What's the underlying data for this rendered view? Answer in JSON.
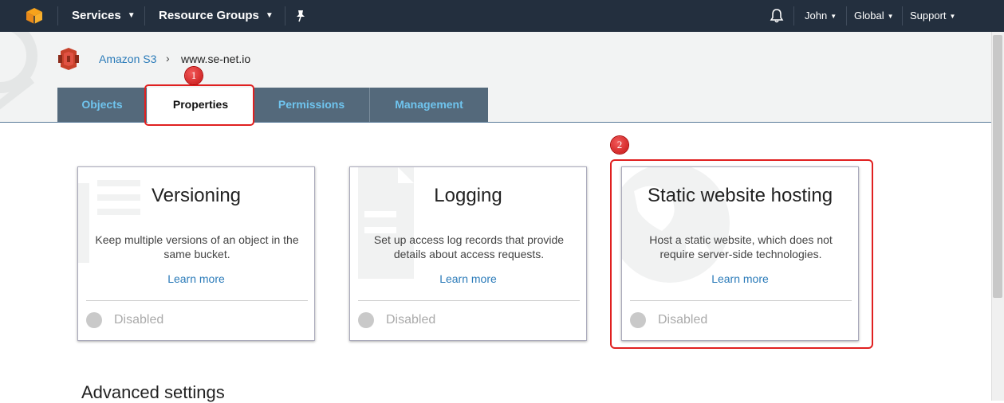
{
  "topnav": {
    "services_label": "Services",
    "resource_groups_label": "Resource Groups",
    "user_label": "John",
    "region_label": "Global",
    "support_label": "Support"
  },
  "breadcrumb": {
    "service_link": "Amazon S3",
    "separator": "›",
    "bucket_name": "www.se-net.io"
  },
  "tabs": [
    {
      "label": "Objects"
    },
    {
      "label": "Properties"
    },
    {
      "label": "Permissions"
    },
    {
      "label": "Management"
    }
  ],
  "badges": {
    "first": "1",
    "second": "2"
  },
  "cards": [
    {
      "title": "Versioning",
      "description": "Keep multiple versions of an object in the same bucket.",
      "link": "Learn more",
      "status": "Disabled"
    },
    {
      "title": "Logging",
      "description": "Set up access log records that provide details about access requests.",
      "link": "Learn more",
      "status": "Disabled"
    },
    {
      "title": "Static website hosting",
      "description": "Host a static website, which does not require server-side technologies.",
      "link": "Learn more",
      "status": "Disabled"
    }
  ],
  "section": {
    "advanced_settings": "Advanced settings"
  },
  "colors": {
    "nav_bg": "#232f3e",
    "tab_bg": "#54697b",
    "tab_text": "#6fc4ee",
    "link": "#2b7bb9",
    "highlight": "#e02020"
  },
  "icons": [
    "aws-cube-icon",
    "pin-icon",
    "bell-icon",
    "s3-bucket-icon"
  ]
}
